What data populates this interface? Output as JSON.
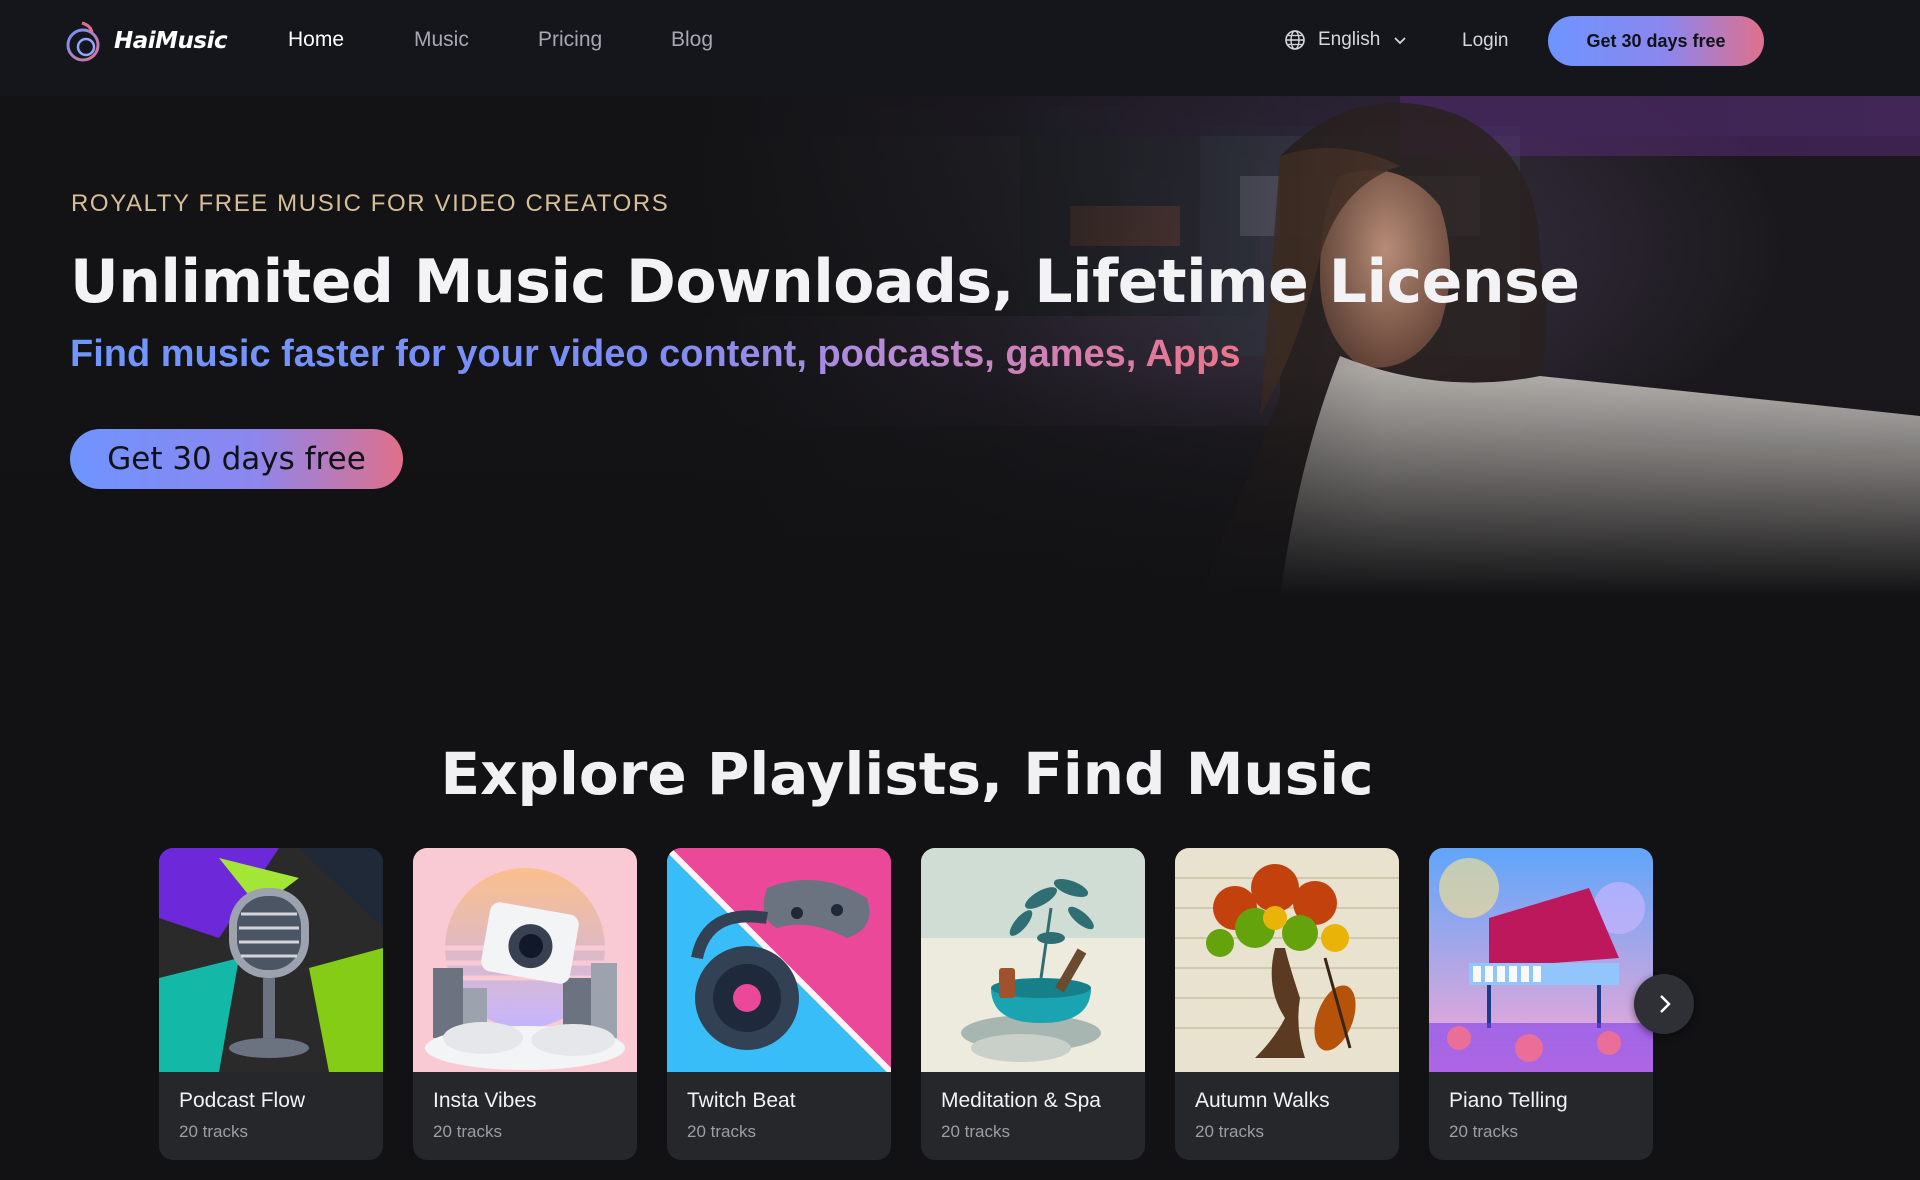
{
  "brand": {
    "name": "HaiMusic",
    "logo_icon": "music-note-icon"
  },
  "nav": {
    "links": [
      {
        "label": "Home",
        "active": true
      },
      {
        "label": "Music",
        "active": false
      },
      {
        "label": "Pricing",
        "active": false
      },
      {
        "label": "Blog",
        "active": false
      }
    ],
    "language": {
      "label": "English",
      "icon": "globe-icon",
      "chevron": "chevron-down-icon"
    },
    "login_label": "Login",
    "cta_label": "Get 30 days free"
  },
  "hero": {
    "eyebrow": "ROYALTY FREE MUSIC FOR VIDEO CREATORS",
    "headline": "Unlimited Music Downloads, Lifetime License",
    "subhead": "Find music faster for your video content, podcasts, games, Apps",
    "cta_label": "Get 30 days free"
  },
  "playlists": {
    "title": "Explore Playlists, Find Music",
    "items": [
      {
        "title": "Podcast Flow",
        "count": "20 tracks"
      },
      {
        "title": "Insta Vibes",
        "count": "20 tracks"
      },
      {
        "title": "Twitch Beat",
        "count": "20 tracks"
      },
      {
        "title": "Meditation & Spa",
        "count": "20 tracks"
      },
      {
        "title": "Autumn Walks",
        "count": "20 tracks"
      },
      {
        "title": "Piano Telling",
        "count": "20 tracks"
      }
    ],
    "next_icon": "chevron-right-icon"
  },
  "colors": {
    "accent_start": "#6f94ff",
    "accent_end": "#e0708a",
    "eyebrow": "#d7bf98",
    "background": "#121214"
  }
}
